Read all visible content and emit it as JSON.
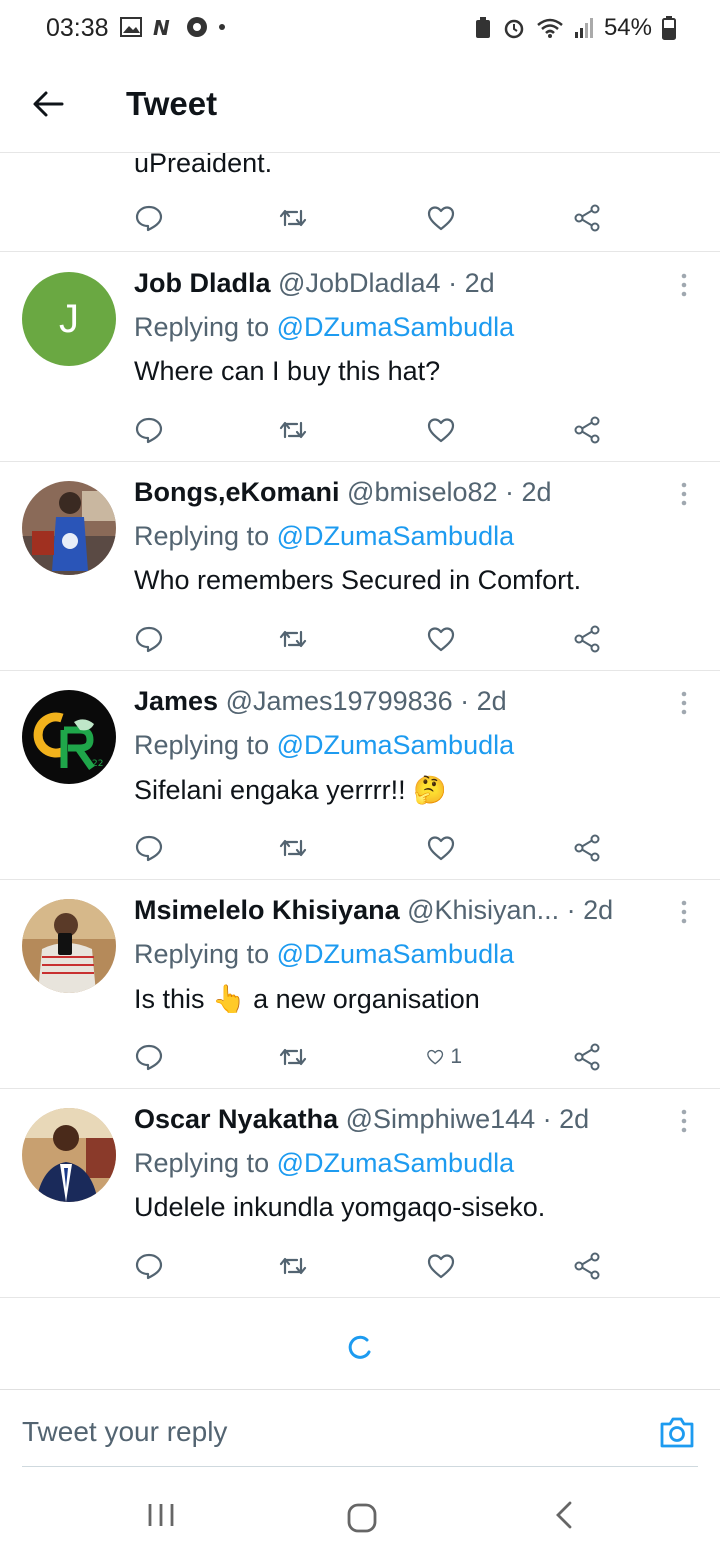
{
  "status_bar": {
    "time": "03:38",
    "battery": "54%"
  },
  "header": {
    "title": "Tweet"
  },
  "partial_tweet": {
    "text": "uPreaident."
  },
  "replies": [
    {
      "name": "Job Dladla",
      "handle": "@JobDladla4",
      "time": "· 2d",
      "replying_label": "Replying to",
      "replying_to": "@DZumaSambudla",
      "text": "Where can I buy this hat?",
      "likes": "",
      "avatar_letter": "J",
      "avatar_color": "#6aa842"
    },
    {
      "name": "Bongs,eKomani",
      "handle": "@bmiselo82",
      "time": "· 2d",
      "replying_label": "Replying to",
      "replying_to": "@DZumaSambudla",
      "text": "Who remembers Secured in Comfort.",
      "likes": ""
    },
    {
      "name": "James",
      "handle": "@James19799836",
      "time": "· 2d",
      "replying_label": "Replying to",
      "replying_to": "@DZumaSambudla",
      "text": "Sifelani engaka yerrrr!! 🤔",
      "likes": ""
    },
    {
      "name": "Msimelelo Khisiyana",
      "handle": "@Khisiyan...",
      "time": "· 2d",
      "replying_label": "Replying to",
      "replying_to": "@DZumaSambudla",
      "text": "Is this 👆 a new organisation",
      "likes": "1"
    },
    {
      "name": "Oscar Nyakatha",
      "handle": "@Simphiwe144",
      "time": "· 2d",
      "replying_label": "Replying to",
      "replying_to": "@DZumaSambudla",
      "text": "Udelele inkundla yomgaqo-siseko.",
      "likes": ""
    }
  ],
  "reply_box": {
    "placeholder": "Tweet your reply"
  },
  "colors": {
    "accent": "#1d9bf0",
    "secondary_text": "#536471",
    "icon": "#536471"
  }
}
